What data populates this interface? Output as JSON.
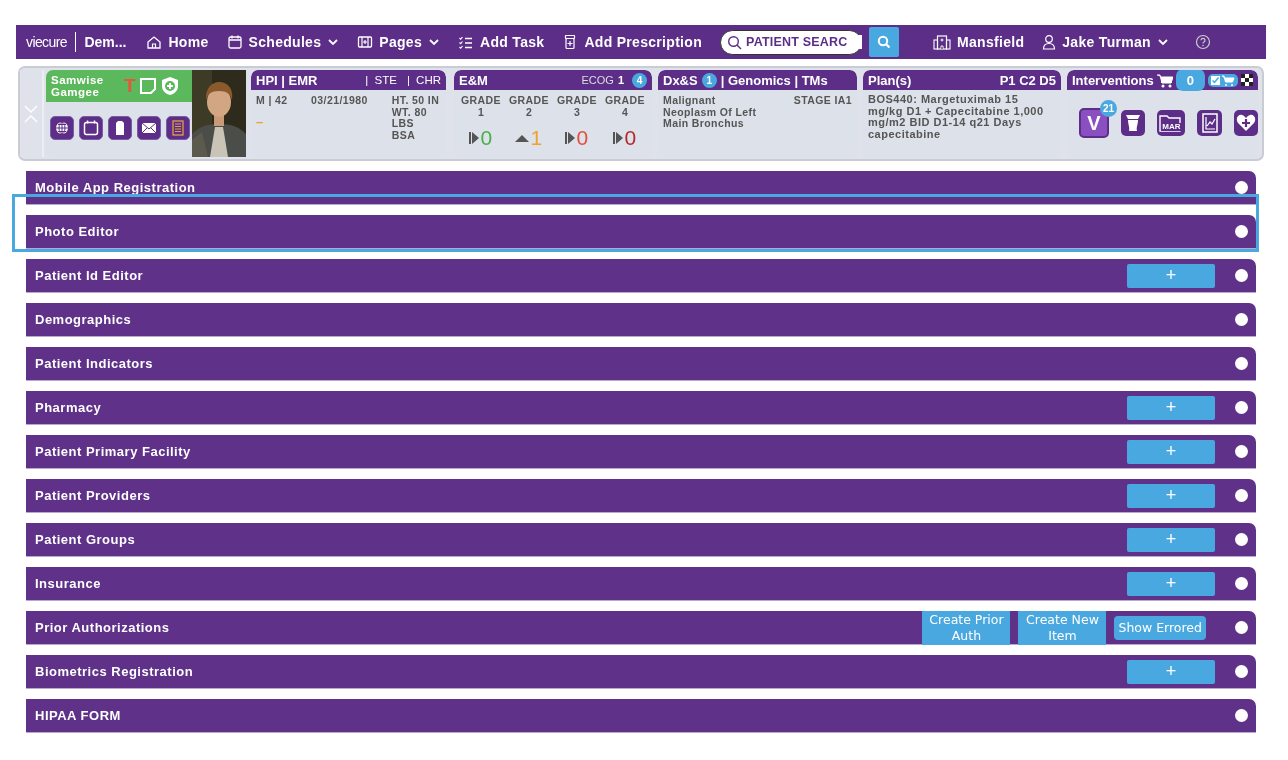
{
  "nav": {
    "logo": "viecure",
    "context": "Dem...",
    "items": [
      {
        "label": "Home",
        "dropdown": false
      },
      {
        "label": "Schedules",
        "dropdown": true
      },
      {
        "label": "Pages",
        "dropdown": true
      },
      {
        "label": "Add Task",
        "dropdown": false
      },
      {
        "label": "Add Prescription",
        "dropdown": false
      }
    ],
    "search": {
      "placeholder": "PATIENT SEARC"
    },
    "facility": "Mansfield",
    "user": "Jake Turman"
  },
  "patient": {
    "name": "Samwise Gamgee",
    "flag": "T"
  },
  "hpi": {
    "title": "HPI | EMR",
    "tabs": [
      "| STE",
      "| CHR"
    ],
    "sex_age": "M | 42",
    "dob": "03/21/1980",
    "dash": "–",
    "vitals": [
      "HT. 50 IN",
      "WT. 80 LBS",
      "BSA"
    ]
  },
  "em": {
    "title": "E&M",
    "ecog_label": "ECOG",
    "ecog_value": "1",
    "badge": "4",
    "grades": [
      {
        "label": "GRADE 1",
        "count": "0",
        "kind": "steady",
        "color": "#4cae4c"
      },
      {
        "label": "GRADE 2",
        "count": "1",
        "kind": "up",
        "color": "#f0a030"
      },
      {
        "label": "GRADE 3",
        "count": "0",
        "kind": "steady",
        "color": "#e0503c"
      },
      {
        "label": "GRADE 4",
        "count": "0",
        "kind": "steady",
        "color": "#b52a2a"
      }
    ]
  },
  "dx": {
    "title": "Dx&S",
    "badge": "1",
    "links": "| Genomics | TMs",
    "diagnosis": "Malignant Neoplasm Of Left Main Bronchus",
    "stage": "STAGE IA1"
  },
  "plan": {
    "title": "Plan(s)",
    "codes": "P1 C2 D5",
    "regimen": "BOS440: Margetuximab 15 mg/kg D1 + Capecitabine 1,000 mg/m2 BID D1-14 q21 Days",
    "drug": "capecitabine"
  },
  "interventions": {
    "title": "Interventions",
    "cart_count": "0",
    "visit_letter": "V",
    "visit_badge": "21",
    "mar_label": "MAR"
  },
  "sections": [
    {
      "title": "Mobile App Registration",
      "selected": false
    },
    {
      "title": "Photo Editor",
      "selected": true
    },
    {
      "title": "Patient Id Editor",
      "selected": false,
      "actions": [
        {
          "label": "+",
          "kind": "add"
        }
      ]
    },
    {
      "title": "Demographics",
      "selected": false
    },
    {
      "title": "Patient Indicators",
      "selected": false
    },
    {
      "title": "Pharmacy",
      "selected": false,
      "actions": [
        {
          "label": "+",
          "kind": "add"
        }
      ]
    },
    {
      "title": "Patient Primary Facility",
      "selected": false,
      "actions": [
        {
          "label": "+",
          "kind": "add"
        }
      ]
    },
    {
      "title": "Patient Providers",
      "selected": false,
      "actions": [
        {
          "label": "+",
          "kind": "add"
        }
      ]
    },
    {
      "title": "Patient Groups",
      "selected": false,
      "actions": [
        {
          "label": "+",
          "kind": "add"
        }
      ]
    },
    {
      "title": "Insurance",
      "selected": false,
      "actions": [
        {
          "label": "+",
          "kind": "add"
        }
      ]
    },
    {
      "title": "Prior Authorizations",
      "selected": false,
      "actions": [
        {
          "label": "Create Prior Auth",
          "kind": "block"
        },
        {
          "label": "Create New Item",
          "kind": "block"
        },
        {
          "label": "Show Errored",
          "kind": "pill"
        }
      ]
    },
    {
      "title": "Biometrics Registration",
      "selected": false,
      "actions": [
        {
          "label": "+",
          "kind": "add"
        }
      ]
    },
    {
      "title": "HIPAA FORM",
      "selected": false
    }
  ]
}
